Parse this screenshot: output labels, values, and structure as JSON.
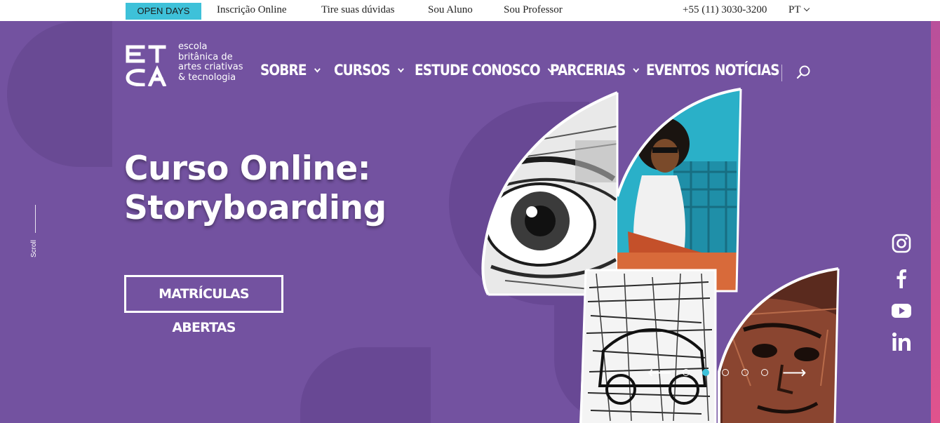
{
  "topbar": {
    "open_days": "OPEN DAYS",
    "links": [
      "Inscrição Online",
      "Tire suas dúvidas",
      "Sou Aluno",
      "Sou Professor"
    ],
    "phone": "+55 (11) 3030-3200",
    "language": "PT"
  },
  "logo": {
    "lines": [
      "escola",
      "britânica de",
      "artes criativas",
      "& tecnologia"
    ]
  },
  "nav": {
    "items": [
      {
        "label": "SOBRE",
        "dropdown": true
      },
      {
        "label": "CURSOS",
        "dropdown": true
      },
      {
        "label": "ESTUDE CONOSCO",
        "dropdown": true
      },
      {
        "label": "PARCERIAS",
        "dropdown": true
      },
      {
        "label": "EVENTOS",
        "dropdown": false
      },
      {
        "label": "NOTÍCIAS",
        "dropdown": false
      }
    ],
    "search_icon": "search-icon"
  },
  "hero": {
    "title_line1": "Curso Online:",
    "title_line2": "Storyboarding",
    "cta": "MATRÍCULAS ABERTAS",
    "scroll_label": "Scroll",
    "active_slide": 2,
    "slide_count": 5
  },
  "social": [
    "instagram-icon",
    "facebook-icon",
    "youtube-icon",
    "linkedin-icon"
  ],
  "colors": {
    "hero_bg": "#7352a0",
    "accent": "#3ec1d9",
    "pink": "#e0538d"
  }
}
